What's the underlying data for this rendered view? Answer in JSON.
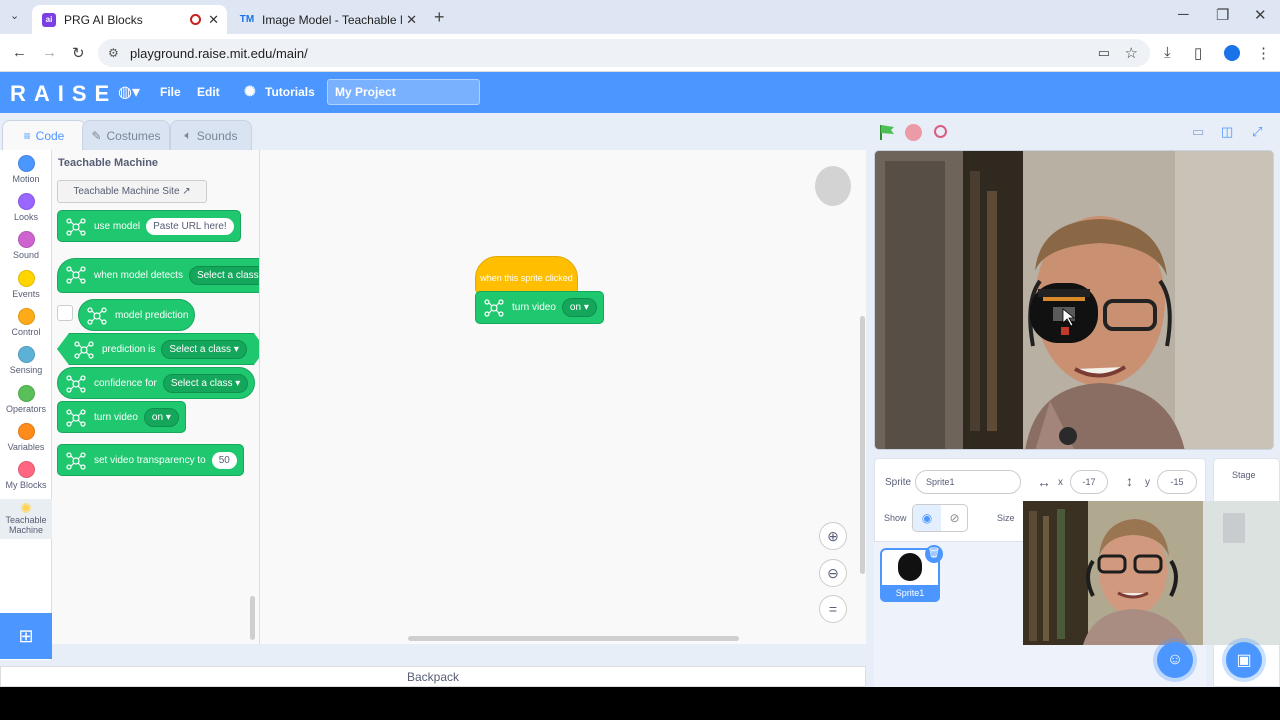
{
  "browser": {
    "tabs": [
      {
        "title": "PRG AI Blocks",
        "favicon": "ai",
        "active": true
      },
      {
        "title": "Image Model - Teachable Mach",
        "favicon": "TM",
        "active": false
      }
    ],
    "url": "playground.raise.mit.edu/main/"
  },
  "header": {
    "logo": "RAISE",
    "menu_file": "File",
    "menu_edit": "Edit",
    "menu_tutorials": "Tutorials",
    "project_name": "My Project"
  },
  "editor_tabs": {
    "code": "Code",
    "costumes": "Costumes",
    "sounds": "Sounds"
  },
  "categories": [
    {
      "label": "Motion",
      "color": "#4c97ff"
    },
    {
      "label": "Looks",
      "color": "#9966ff"
    },
    {
      "label": "Sound",
      "color": "#cf63cf"
    },
    {
      "label": "Events",
      "color": "#ffd500"
    },
    {
      "label": "Control",
      "color": "#ffab19"
    },
    {
      "label": "Sensing",
      "color": "#5cb1d6"
    },
    {
      "label": "Operators",
      "color": "#59c059"
    },
    {
      "label": "Variables",
      "color": "#ff8c1a"
    },
    {
      "label": "My Blocks",
      "color": "#ff6680"
    },
    {
      "label": "Teachable Machine",
      "color": "#ffe9a0"
    }
  ],
  "palette": {
    "title": "Teachable Machine",
    "site_button": "Teachable Machine Site ↗",
    "blocks": {
      "use_model": "use model",
      "use_model_input": "Paste URL here!",
      "when_detects": "when model detects",
      "select_class": "Select a class",
      "model_prediction": "model prediction",
      "prediction_is": "prediction is",
      "confidence_for": "confidence for",
      "turn_video": "turn video",
      "video_on": "on",
      "set_transparency": "set video transparency to",
      "transparency_value": "50"
    }
  },
  "script": {
    "hat": "when this sprite clicked",
    "turn_video": "turn video",
    "video_on": "on"
  },
  "backpack": "Backpack",
  "sprite_info": {
    "sprite_label": "Sprite",
    "sprite_name": "Sprite1",
    "x_label": "x",
    "x_value": "-17",
    "y_label": "y",
    "y_value": "-15",
    "show_label": "Show",
    "size_label": "Size",
    "thumbnail_name": "Sprite1"
  },
  "stage_pane": {
    "label": "Stage"
  },
  "colors": {
    "accent": "#4c97ff",
    "extension_green": "#1fc76f",
    "events_yellow": "#ffbf00"
  }
}
